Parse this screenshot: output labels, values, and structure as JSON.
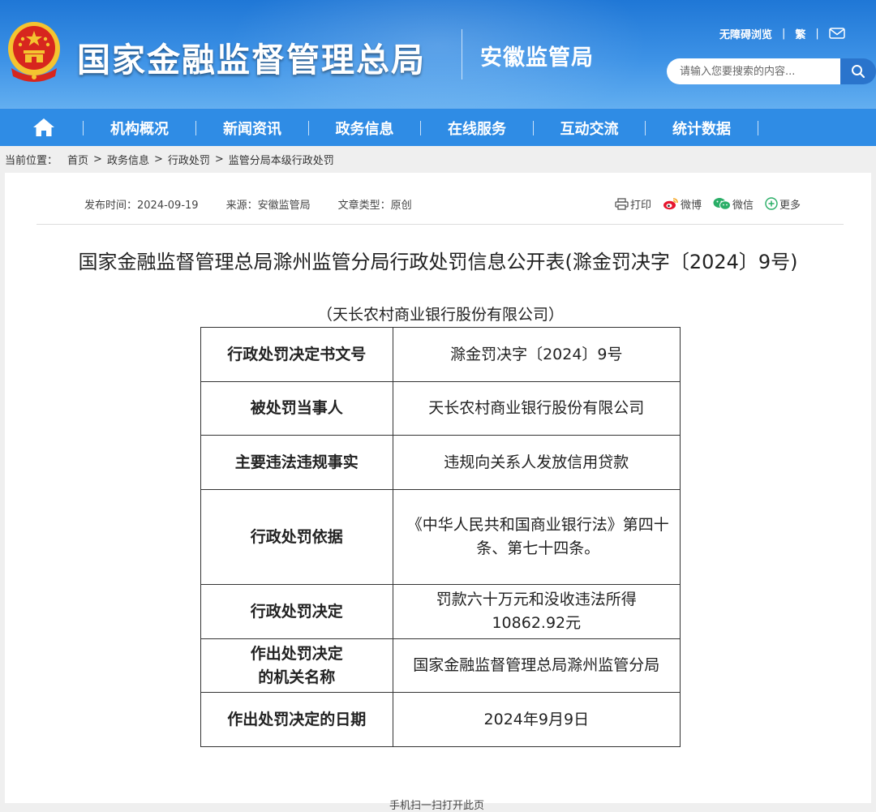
{
  "header": {
    "site_title": "国家金融监督管理总局",
    "sub_title": "安徽监管局",
    "accessibility_link": "无障碍浏览",
    "traditional_link": "繁",
    "search_placeholder": "请输入您要搜索的内容...",
    "colors": {
      "header_blue": "#2f8ce5",
      "emblem_red": "#d7261e",
      "emblem_gold": "#f4c430"
    }
  },
  "nav": {
    "items": [
      "机构概况",
      "新闻资讯",
      "政务信息",
      "在线服务",
      "互动交流",
      "统计数据"
    ]
  },
  "breadcrumb": {
    "label": "当前位置：",
    "items": [
      "首页",
      "政务信息",
      "行政处罚",
      "监管分局本级行政处罚"
    ]
  },
  "meta": {
    "publish_time": "发布时间：2024-09-19",
    "source": "来源：安徽监管局",
    "article_type": "文章类型：原创"
  },
  "share": {
    "print": "打印",
    "weibo": "微博",
    "wechat": "微信",
    "more": "更多"
  },
  "document": {
    "title": "国家金融监督管理总局滁州监管分局行政处罚信息公开表(滁金罚决字〔2024〕9号)",
    "org_line": "（天长农村商业银行股份有限公司）",
    "rows": [
      {
        "key": "行政处罚决定书文号",
        "value": "滁金罚决字〔2024〕9号"
      },
      {
        "key": "被处罚当事人",
        "value": "天长农村商业银行股份有限公司"
      },
      {
        "key": "主要违法违规事实",
        "value": "违规向关系人发放信用贷款"
      },
      {
        "key": "行政处罚依据",
        "value": "《中华人民共和国商业银行法》第四十条、第七十四条。"
      },
      {
        "key": "行政处罚决定",
        "value": "罚款六十万元和没收违法所得10862.92元"
      },
      {
        "key": "作出处罚决定的机关名称",
        "value": "国家金融监督管理总局滁州监管分局"
      },
      {
        "key": "作出处罚决定的日期",
        "value": "2024年9月9日"
      }
    ]
  },
  "footer": {
    "peek_text": "手机扫一扫打开此页"
  }
}
